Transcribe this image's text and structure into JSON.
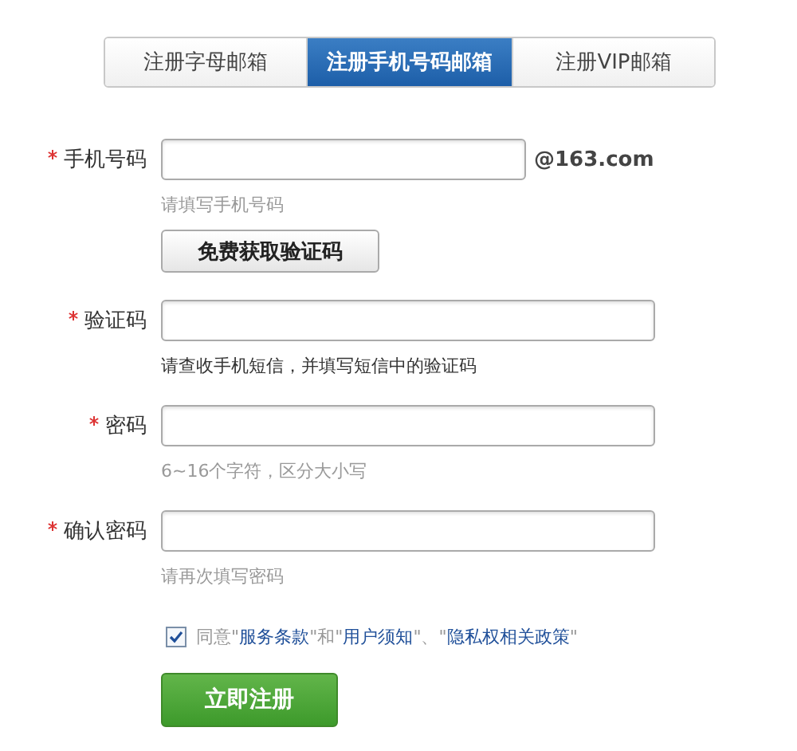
{
  "tabs": [
    {
      "label": "注册字母邮箱",
      "selected": false
    },
    {
      "label": "注册手机号码邮箱",
      "selected": true
    },
    {
      "label": "注册VIP邮箱",
      "selected": false
    }
  ],
  "fields": [
    {
      "label": "手机号码",
      "required": true,
      "suffix": "@163.com",
      "hint": "请填写手机号码",
      "hint_emphasized": false,
      "button": "免费获取验证码"
    },
    {
      "label": "验证码",
      "required": true,
      "hint": "请查收手机短信，并填写短信中的验证码",
      "hint_emphasized": true
    },
    {
      "label": "密码",
      "required": true,
      "hint": "6~16个字符，区分大小写",
      "hint_emphasized": false
    },
    {
      "label": "确认密码",
      "required": true,
      "hint": "请再次填写密码",
      "hint_emphasized": false
    }
  ],
  "agreement": {
    "checked": true,
    "parts": [
      {
        "kind": "text",
        "text": "同意\""
      },
      {
        "kind": "link",
        "text": "服务条款"
      },
      {
        "kind": "text",
        "text": "\"和\""
      },
      {
        "kind": "link",
        "text": "用户须知"
      },
      {
        "kind": "text",
        "text": "\"、\""
      },
      {
        "kind": "link",
        "text": "隐私权相关政策"
      },
      {
        "kind": "text",
        "text": "\""
      }
    ]
  },
  "submit": "立即注册"
}
